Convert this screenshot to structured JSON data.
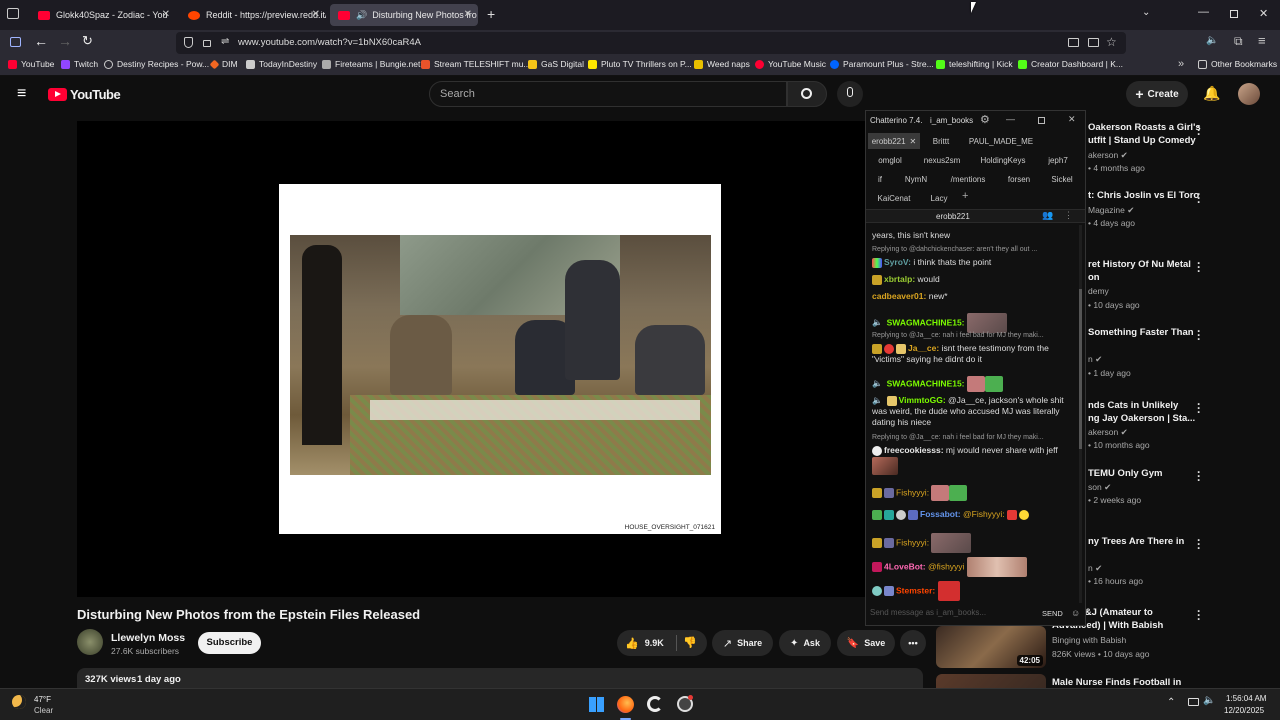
{
  "browser": {
    "tabs": [
      {
        "label": "Glokk40Spaz - Zodiac - You",
        "favcolor": "#ff0033"
      },
      {
        "label": "Reddit - https://preview.redd.it/",
        "favcolor": "#ff4500"
      },
      {
        "label": "Disturbing New Photos fro",
        "favcolor": "#ff0033"
      }
    ],
    "url": "www.youtube.com/watch?v=1bNX60caR4A",
    "bookmarks": [
      "YouTube",
      "Twitch",
      "Destiny Recipes - Pow...",
      "DIM",
      "TodayInDestiny",
      "Fireteams | Bungie.net",
      "Stream TELESHIFT mu...",
      "GaS Digital",
      "Pluto TV Thrillers on P...",
      "Weed naps",
      "YouTube Music",
      "Paramount Plus - Stre...",
      "teleshifting | Kick",
      "Creator Dashboard | K..."
    ],
    "other_bookmarks": "Other Bookmarks"
  },
  "youtube": {
    "logo": "YouTube",
    "search_placeholder": "Search",
    "create_label": "Create",
    "slide_caption": "HOUSE_OVERSIGHT_071621",
    "video_title": "Disturbing New Photos from the Epstein Files Released",
    "channel_name": "Llewelyn Moss",
    "subscribers": "27.6K subscribers",
    "subscribe_label": "Subscribe",
    "likes": "9.9K",
    "share_label": "Share",
    "ask_label": "Ask",
    "save_label": "Save",
    "views": "327K views",
    "age": "1 day ago",
    "sidebar": [
      {
        "title_a": "Oakerson Roasts a Girl's",
        "title_b": "utfit | Stand Up Comedy",
        "channel": "akerson",
        "meta": "• 4 months ago"
      },
      {
        "title_a": "t: Chris Joslin vs El Toro",
        "title_b": "",
        "channel": "Magazine",
        "meta": "• 4 days ago"
      },
      {
        "title_a": "ret History Of Nu Metal",
        "title_b": "on",
        "channel": "demy",
        "meta": "• 10 days ago"
      },
      {
        "title_a": "Something Faster Than",
        "title_b": "",
        "channel": "n",
        "meta": "• 1 day ago"
      },
      {
        "title_a": "nds Cats in Unlikely",
        "title_b": "ng Jay Oakerson | Sta...",
        "channel": "akerson",
        "meta": "• 10 months ago"
      },
      {
        "title_a": "TEMU Only Gym",
        "title_b": "",
        "channel": "son",
        "meta": "• 2 weeks ago"
      },
      {
        "title_a": "ny Trees Are There in",
        "title_b": "",
        "channel": "n",
        "meta": "• 16 hours ago"
      },
      {
        "title_a": "s of PB&J (Amateur to",
        "title_b": "Advanced) | With Babish",
        "channel": "Binging with Babish",
        "meta": "826K views • 10 days ago"
      },
      {
        "title_a": "Male Nurse Finds Football in",
        "title_b": "",
        "channel": "",
        "meta": ""
      }
    ],
    "duration": "42:05"
  },
  "chatterino": {
    "title": "Chatterino 7.4.",
    "user": "i_am_books",
    "tabs_row1": [
      "erobb221",
      "Brittt",
      "PAUL_MADE_ME"
    ],
    "tabs_row2": [
      "omglol",
      "nexus2sm",
      "HoldingKeys",
      "jeph7"
    ],
    "tabs_row3": [
      "if",
      "NymN",
      "/mentions",
      "forsen",
      "Sickel"
    ],
    "tabs_row4": [
      "KaiCenat",
      "Lacy"
    ],
    "channel": "erobb221",
    "messages": [
      {
        "kind": "text",
        "user": "",
        "text": "years, this isn't knew"
      },
      {
        "kind": "reply",
        "text": "Replying to @dahchickenchaser: aren't they all out ..."
      },
      {
        "kind": "msg",
        "user": "SyroV:",
        "color": "#5f9ea0",
        "text": "i think thats the point"
      },
      {
        "kind": "msg",
        "user": "xbrtalp:",
        "color": "#9acd32",
        "text": "would"
      },
      {
        "kind": "msg",
        "user": "cadbeaver01:",
        "color": "#daa520",
        "text": "new*"
      },
      {
        "kind": "msg",
        "user": "SWAGMACHINE15:",
        "color": "#7cfc00",
        "text": ""
      },
      {
        "kind": "reply",
        "text": "Replying to @Ja__ce: nah i feel bad for MJ they maki..."
      },
      {
        "kind": "msg",
        "user": "Ja__ce:",
        "color": "#daa520",
        "text": "isnt there testimony from the"
      },
      {
        "kind": "text",
        "user": "",
        "text": "\"victims\" saying he didnt do it"
      },
      {
        "kind": "msg",
        "user": "SWAGMACHINE15:",
        "color": "#7cfc00",
        "text": ""
      },
      {
        "kind": "msg",
        "user": "VimmtoGG:",
        "color": "#7cfc00",
        "text": "@Ja__ce, jackson's whole shit"
      },
      {
        "kind": "text",
        "user": "",
        "text": "was weird, the dude who accused MJ was literally"
      },
      {
        "kind": "text",
        "user": "",
        "text": "dating his niece"
      },
      {
        "kind": "reply",
        "text": "Replying to @Ja__ce: nah i feel bad for MJ they maki..."
      },
      {
        "kind": "msg",
        "user": "freecookiesss:",
        "color": "#e6e6e6",
        "text": "mj would never share with jeff"
      },
      {
        "kind": "msg",
        "user": "Fishyyyi:",
        "color": "#daa520",
        "text": ""
      },
      {
        "kind": "msg",
        "user": "Fossabot:",
        "color": "#6495ed",
        "text": "@Fishyyyi:"
      },
      {
        "kind": "msg",
        "user": "Fishyyyi:",
        "color": "#daa520",
        "text": ""
      },
      {
        "kind": "msg",
        "user": "4LoveBot:",
        "color": "#ff69b4",
        "text": "@fishyyyi"
      },
      {
        "kind": "msg",
        "user": "Stemster:",
        "color": "#ff4500",
        "text": ""
      }
    ],
    "input_placeholder": "Send message as i_am_books...",
    "send_label": "SEND"
  },
  "taskbar": {
    "temp": "47°F",
    "weather": "Clear",
    "time": "1:56:04 AM",
    "date": "12/20/2025"
  }
}
